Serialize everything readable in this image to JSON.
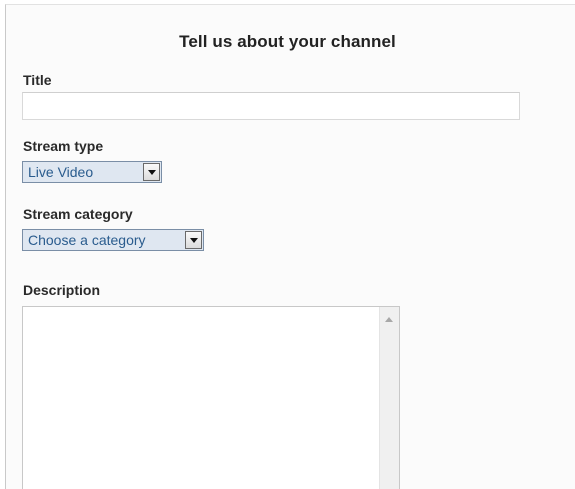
{
  "form": {
    "heading": "Tell us about your channel",
    "title": {
      "label": "Title",
      "value": "",
      "placeholder": ""
    },
    "stream_type": {
      "label": "Stream type",
      "selected": "Live Video"
    },
    "stream_category": {
      "label": "Stream category",
      "selected": "Choose a category"
    },
    "description": {
      "label": "Description",
      "value": ""
    }
  },
  "colors": {
    "select_background": "#dfe7f1",
    "select_text": "#2a5c8e",
    "select_border": "#7a8ea6"
  }
}
